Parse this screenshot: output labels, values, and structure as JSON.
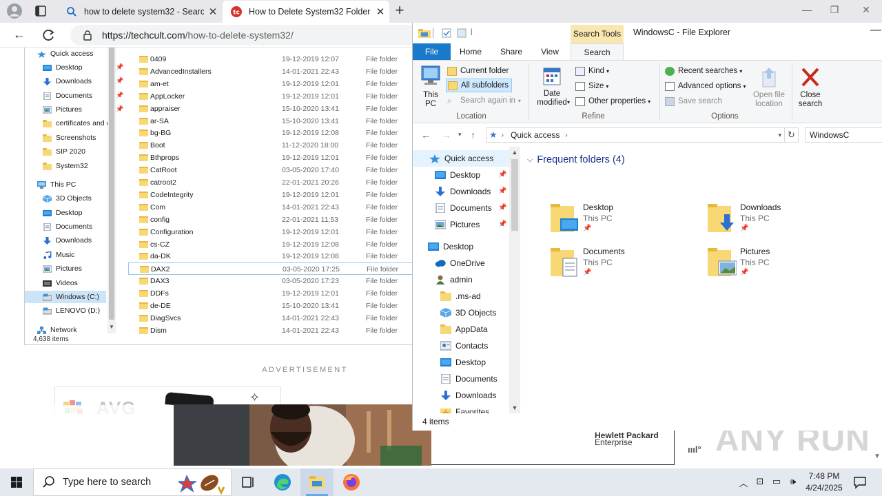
{
  "browser": {
    "tabs": [
      {
        "title": "how to delete system32 - Search"
      },
      {
        "title": "How to Delete System32 Folder in"
      }
    ],
    "url_host": "https://techcult.com",
    "url_path": "/how-to-delete-system32/"
  },
  "webpage": {
    "screenshot_nav": [
      {
        "label": "Quick access",
        "icon": "star-icon"
      },
      {
        "label": "Desktop",
        "icon": "desktop-icon",
        "pinned": true
      },
      {
        "label": "Downloads",
        "icon": "download-icon",
        "pinned": true
      },
      {
        "label": "Documents",
        "icon": "documents-icon",
        "pinned": true
      },
      {
        "label": "Pictures",
        "icon": "pictures-icon",
        "pinned": true
      },
      {
        "label": "certificates and c",
        "icon": "folder-icon"
      },
      {
        "label": "Screenshots",
        "icon": "folder-icon"
      },
      {
        "label": "SIP 2020",
        "icon": "folder-icon"
      },
      {
        "label": "System32",
        "icon": "folder-icon"
      },
      {
        "label": "This PC",
        "icon": "computer-icon"
      },
      {
        "label": "3D Objects",
        "icon": "cube-icon"
      },
      {
        "label": "Desktop",
        "icon": "desktop-icon"
      },
      {
        "label": "Documents",
        "icon": "documents-icon"
      },
      {
        "label": "Downloads",
        "icon": "download-icon"
      },
      {
        "label": "Music",
        "icon": "music-icon"
      },
      {
        "label": "Pictures",
        "icon": "pictures-icon"
      },
      {
        "label": "Videos",
        "icon": "video-icon"
      },
      {
        "label": "Windows (C:)",
        "icon": "drive-icon"
      },
      {
        "label": "LENOVO (D:)",
        "icon": "drive-icon"
      },
      {
        "label": "Network",
        "icon": "network-icon"
      }
    ],
    "screenshot_count": "4,638 items",
    "screenshot_files": [
      {
        "name": "0409",
        "date": "19-12-2019 12:07",
        "type": "File folder"
      },
      {
        "name": "AdvancedInstallers",
        "date": "14-01-2021 22:43",
        "type": "File folder"
      },
      {
        "name": "am-et",
        "date": "19-12-2019 12:01",
        "type": "File folder"
      },
      {
        "name": "AppLocker",
        "date": "19-12-2019 12:01",
        "type": "File folder"
      },
      {
        "name": "appraiser",
        "date": "15-10-2020 13:41",
        "type": "File folder"
      },
      {
        "name": "ar-SA",
        "date": "15-10-2020 13:41",
        "type": "File folder"
      },
      {
        "name": "bg-BG",
        "date": "19-12-2019 12:08",
        "type": "File folder"
      },
      {
        "name": "Boot",
        "date": "11-12-2020 18:00",
        "type": "File folder"
      },
      {
        "name": "Bthprops",
        "date": "19-12-2019 12:01",
        "type": "File folder"
      },
      {
        "name": "CatRoot",
        "date": "03-05-2020 17:40",
        "type": "File folder"
      },
      {
        "name": "catroot2",
        "date": "22-01-2021 20:26",
        "type": "File folder"
      },
      {
        "name": "CodeIntegrity",
        "date": "19-12-2019 12:01",
        "type": "File folder"
      },
      {
        "name": "Com",
        "date": "14-01-2021 22:43",
        "type": "File folder"
      },
      {
        "name": "config",
        "date": "22-01-2021 11:53",
        "type": "File folder"
      },
      {
        "name": "Configuration",
        "date": "19-12-2019 12:01",
        "type": "File folder"
      },
      {
        "name": "cs-CZ",
        "date": "19-12-2019 12:08",
        "type": "File folder"
      },
      {
        "name": "da-DK",
        "date": "19-12-2019 12:08",
        "type": "File folder"
      },
      {
        "name": "DAX2",
        "date": "03-05-2020 17:25",
        "type": "File folder"
      },
      {
        "name": "DAX3",
        "date": "03-05-2020 17:23",
        "type": "File folder"
      },
      {
        "name": "DDFs",
        "date": "19-12-2019 12:01",
        "type": "File folder"
      },
      {
        "name": "de-DE",
        "date": "15-10-2020 13:41",
        "type": "File folder"
      },
      {
        "name": "DiagSvcs",
        "date": "14-01-2021 22:43",
        "type": "File folder"
      },
      {
        "name": "Dism",
        "date": "14-01-2021 22:43",
        "type": "File folder"
      }
    ],
    "ad_label": "ADVERTISEMENT",
    "avg_text": "AVG",
    "hpe_line1": "Hewlett Packard",
    "hpe_line2": "Enterprise",
    "watermark": "ANY RUN"
  },
  "explorer": {
    "search_tools_label": "Search Tools",
    "title": "WindowsC - File Explorer",
    "ribbon_tabs": [
      "File",
      "Home",
      "Share",
      "View",
      "Search"
    ],
    "location": {
      "this_pc": "This\nPC",
      "current_folder": "Current folder",
      "all_subfolders": "All subfolders",
      "search_again": "Search again in",
      "group": "Location"
    },
    "refine": {
      "date_modified": "Date\nmodified",
      "kind": "Kind",
      "size": "Size",
      "other_properties": "Other properties",
      "group": "Refine"
    },
    "options": {
      "recent_searches": "Recent searches",
      "advanced_options": "Advanced options",
      "save_search": "Save search",
      "open_file_location": "Open file\nlocation",
      "group": "Options"
    },
    "close_search": "Close\nsearch",
    "breadcrumb": "Quick access",
    "search_box": "WindowsC",
    "tree": [
      {
        "label": "Quick access",
        "icon": "star-icon"
      },
      {
        "label": "Desktop",
        "icon": "desktop-icon",
        "pinned": true
      },
      {
        "label": "Downloads",
        "icon": "download-icon",
        "pinned": true
      },
      {
        "label": "Documents",
        "icon": "documents-icon",
        "pinned": true
      },
      {
        "label": "Pictures",
        "icon": "pictures-icon",
        "pinned": true
      },
      {
        "label": "Desktop",
        "icon": "desktop-icon"
      },
      {
        "label": "OneDrive",
        "icon": "cloud-icon"
      },
      {
        "label": "admin",
        "icon": "user-icon"
      },
      {
        "label": ".ms-ad",
        "icon": "folder-icon"
      },
      {
        "label": "3D Objects",
        "icon": "cube-icon"
      },
      {
        "label": "AppData",
        "icon": "folder-icon"
      },
      {
        "label": "Contacts",
        "icon": "contacts-icon"
      },
      {
        "label": "Desktop",
        "icon": "desktop-icon"
      },
      {
        "label": "Documents",
        "icon": "documents-icon"
      },
      {
        "label": "Downloads",
        "icon": "download-icon"
      },
      {
        "label": "Favorites",
        "icon": "star-folder-icon"
      }
    ],
    "group_header": "Frequent folders (4)",
    "tiles": [
      {
        "name": "Desktop",
        "sub": "This PC",
        "overlay": "desktop"
      },
      {
        "name": "Downloads",
        "sub": "This PC",
        "overlay": "download"
      },
      {
        "name": "Documents",
        "sub": "This PC",
        "overlay": "documents"
      },
      {
        "name": "Pictures",
        "sub": "This PC",
        "overlay": "pictures"
      }
    ],
    "status": "4 items"
  },
  "taskbar": {
    "search_placeholder": "Type here to search",
    "time": "7:48 PM",
    "date": "4/24/2025"
  },
  "colors": {
    "file_tab": "#1979ca",
    "search_tools": "#f9e7b0",
    "folder_yellow": "#f8d775",
    "close_red": "#c42b1c"
  }
}
